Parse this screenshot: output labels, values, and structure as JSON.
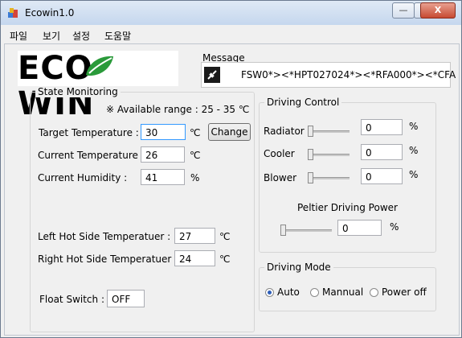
{
  "window": {
    "title": "Ecowin1.0",
    "min_label": "—",
    "max_label": "□",
    "close_label": "X"
  },
  "menu": [
    "파일",
    "보기",
    "설정",
    "도움말"
  ],
  "logo": {
    "text": "ECO WIN",
    "accent": "#2a9a3a"
  },
  "message": {
    "label": "Message",
    "text": "FSW0*><*HPT027024*><*RFA000*><*CFA"
  },
  "state": {
    "title": "State Monitoring",
    "range": "※ Available range : 25 - 35 ℃",
    "target_label": "Target Temperature :",
    "target_value": "30",
    "target_unit": "℃",
    "change_label": "Change",
    "current_temp_label": "Current Temperature :",
    "current_temp_value": "26",
    "current_temp_unit": "℃",
    "humidity_label": "Current Humidity :",
    "humidity_value": "41",
    "humidity_unit": "%",
    "left_label": "Left Hot Side Temperatuer :",
    "left_value": "27",
    "left_unit": "℃",
    "right_label": "Right Hot Side Temperatuer :",
    "right_value": "24",
    "right_unit": "℃",
    "float_label": "Float Switch :",
    "float_value": "OFF"
  },
  "driving": {
    "title": "Driving Control",
    "radiator_label": "Radiator",
    "radiator_value": "0",
    "radiator_unit": "%",
    "cooler_label": "Cooler",
    "cooler_value": "0",
    "cooler_unit": "%",
    "blower_label": "Blower",
    "blower_value": "0",
    "blower_unit": "%",
    "peltier_label": "Peltier Driving Power",
    "peltier_value": "0",
    "peltier_unit": "%"
  },
  "mode": {
    "title": "Driving Mode",
    "options": [
      "Auto",
      "Mannual",
      "Power off"
    ],
    "selected": "Auto"
  }
}
